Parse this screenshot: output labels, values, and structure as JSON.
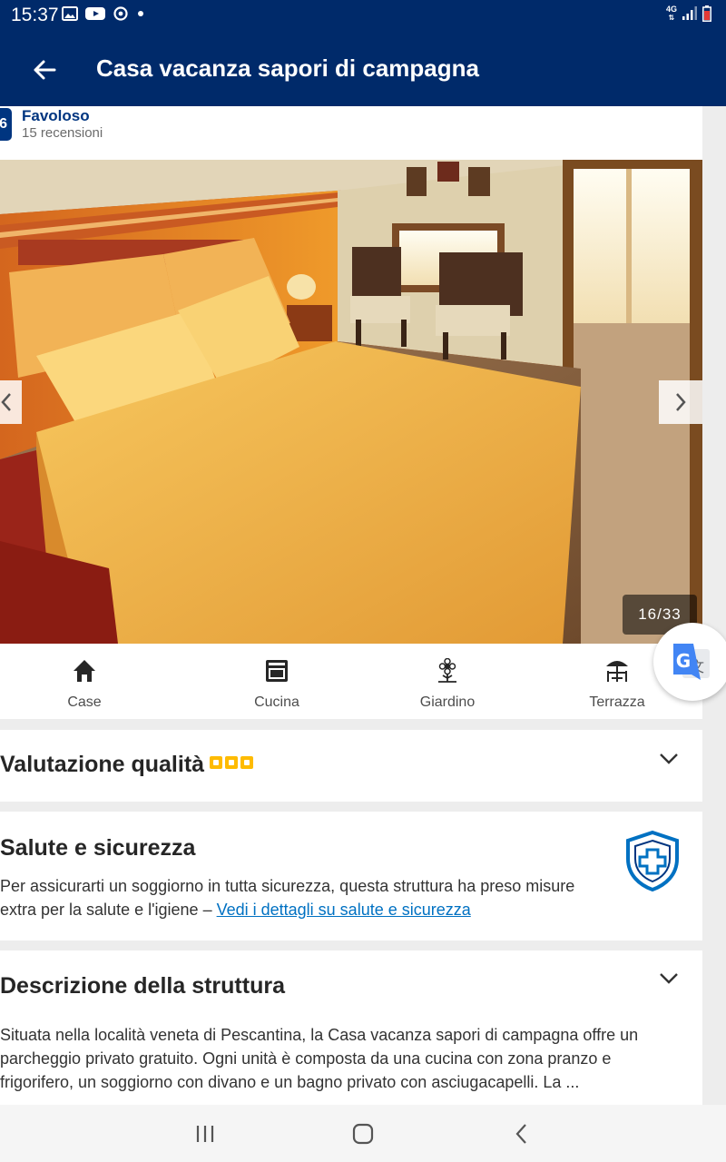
{
  "status_bar": {
    "time": "15:37",
    "network": "4G",
    "icons": [
      "gallery-icon",
      "youtube-icon",
      "sync-icon",
      "dot-icon",
      "signal-icon",
      "battery-icon"
    ]
  },
  "app_bar": {
    "title": "Casa vacanza sapori di campagna",
    "back_icon": "arrow-back-icon"
  },
  "rating": {
    "score": "6",
    "label": "Favoloso",
    "reviews": "15 recensioni"
  },
  "gallery": {
    "counter": "16/33",
    "prev_icon": "chevron-left-icon",
    "next_icon": "chevron-right-icon"
  },
  "facilities": [
    {
      "label": "Case",
      "icon": "house-icon"
    },
    {
      "label": "Cucina",
      "icon": "oven-icon"
    },
    {
      "label": "Giardino",
      "icon": "flower-icon"
    },
    {
      "label": "Terrazza",
      "icon": "umbrella-table-icon"
    }
  ],
  "quality": {
    "title": "Valutazione qualità",
    "stars": 3
  },
  "health": {
    "title": "Salute e sicurezza",
    "line1": "Per assicurarti un soggiorno in tutta sicurezza, questa struttura ha preso misure",
    "line2_prefix": "extra per la salute e l'igiene – ",
    "link": "Vedi i dettagli su salute e sicurezza"
  },
  "description": {
    "title": "Descrizione della struttura",
    "line1": "Situata nella località veneta di Pescantina, la Casa vacanza sapori di campagna offre un",
    "line2": "parcheggio privato gratuito. Ogni unità è composta da una cucina con zona pranzo e",
    "line3": "frigorifero, un soggiorno con divano e un bagno privato con asciugacapelli. La ..."
  },
  "colors": {
    "brand_blue": "#003580",
    "header_blue": "#002a6a",
    "link_blue": "#0071c2",
    "star_yellow": "#febb02"
  }
}
